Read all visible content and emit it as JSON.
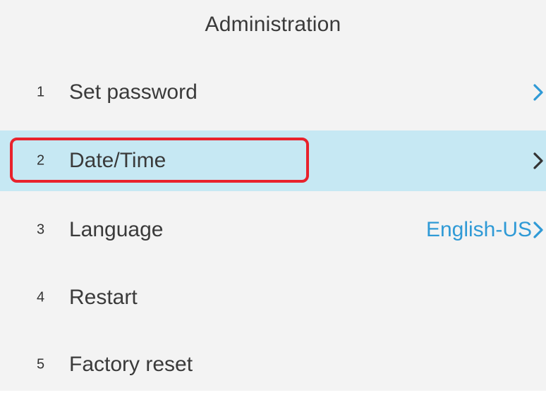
{
  "screen": {
    "title": "Administration"
  },
  "menu": {
    "items": [
      {
        "number": "1",
        "label": "Set password",
        "value": "",
        "chevron_color": "#2f9ad6",
        "chevron_icon": "chevron-right-icon"
      },
      {
        "number": "2",
        "label": "Date/Time",
        "value": "",
        "chevron_color": "#333333",
        "chevron_icon": "chevron-right-icon",
        "selected": true
      },
      {
        "number": "3",
        "label": "Language",
        "value": "English-US",
        "chevron_color": "#2f9ad6",
        "chevron_icon": "chevron-right-icon"
      },
      {
        "number": "4",
        "label": "Restart",
        "value": ""
      },
      {
        "number": "5",
        "label": "Factory reset",
        "value": ""
      }
    ]
  },
  "colors": {
    "background": "#f3f3f3",
    "selected_row": "#c6e8f3",
    "accent_blue": "#2f9ad6",
    "highlight_red": "#e8222c"
  }
}
